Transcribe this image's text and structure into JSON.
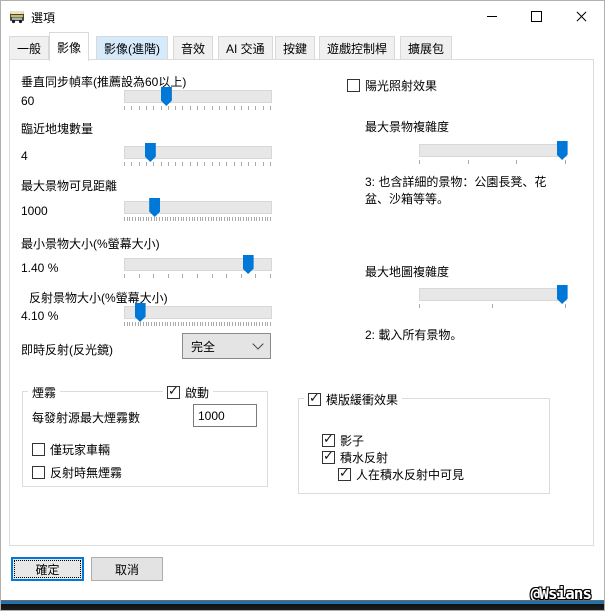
{
  "window": {
    "title": "選項",
    "watermark": "@Wsians"
  },
  "titlebar_icons": {
    "app": "bus-icon",
    "minimize": "minimize-icon",
    "maximize": "maximize-icon",
    "close": "close-icon"
  },
  "tabs": [
    {
      "label": "一般",
      "state": "normal"
    },
    {
      "label": "影像",
      "state": "selected"
    },
    {
      "label": "影像(進階)",
      "state": "hover"
    },
    {
      "label": "音效",
      "state": "normal"
    },
    {
      "label": "AI 交通",
      "state": "normal"
    },
    {
      "label": "按鍵",
      "state": "normal"
    },
    {
      "label": "遊戲控制桿",
      "state": "normal"
    },
    {
      "label": "擴展包",
      "state": "normal"
    }
  ],
  "left": {
    "sliders": [
      {
        "label": "垂直同步幀率(推薦設為60以上)",
        "value": "60",
        "fraction": 0.28,
        "ticks": 21
      },
      {
        "label": "臨近地塊數量",
        "value": "4",
        "fraction": 0.17,
        "ticks": 21
      },
      {
        "label": "最大景物可見距離",
        "value": "1000",
        "fraction": 0.2,
        "ticks": 55
      },
      {
        "label": "最小景物大小(%螢幕大小)",
        "value": "1.40 %",
        "fraction": 0.84,
        "ticks": 11
      },
      {
        "label": "反射景物大小(%螢幕大小)",
        "value": "4.10 %",
        "fraction": 0.1,
        "ticks": 55
      }
    ],
    "mirror": {
      "label": "即時反射(反光鏡)",
      "value": "完全"
    },
    "smoke_group": {
      "caption": "煙霧",
      "enable": {
        "label": "啟動",
        "checked": true
      },
      "max_label": "每發射源最大煙霧數",
      "max_value": "1000",
      "player_only": {
        "label": "僅玩家車輛",
        "checked": false
      },
      "no_reflect": {
        "label": "反射時無煙霧",
        "checked": false
      }
    }
  },
  "right": {
    "sunlight": {
      "label": "陽光照射效果",
      "checked": false
    },
    "scenery_complexity": {
      "label": "最大景物複雜度",
      "fraction": 0.97,
      "ticks": 4,
      "desc": "3: 也含詳細的景物：公園長凳、花盆、沙箱等等。"
    },
    "map_complexity": {
      "label": "最大地圖複雜度",
      "fraction": 0.97,
      "ticks": 3,
      "desc": "2: 載入所有景物。"
    },
    "stencil_group": {
      "caption": {
        "label": "模版緩衝效果",
        "checked": true
      },
      "items": [
        {
          "label": "影子",
          "checked": true,
          "indent": 0
        },
        {
          "label": "積水反射",
          "checked": true,
          "indent": 0
        },
        {
          "label": "人在積水反射中可見",
          "checked": true,
          "indent": 1
        }
      ]
    }
  },
  "footer": {
    "ok": "確定",
    "cancel": "取消"
  },
  "colors": {
    "accent": "#0078d7",
    "tab_hover": "#d5eafb",
    "track": "#e7e7e7"
  }
}
